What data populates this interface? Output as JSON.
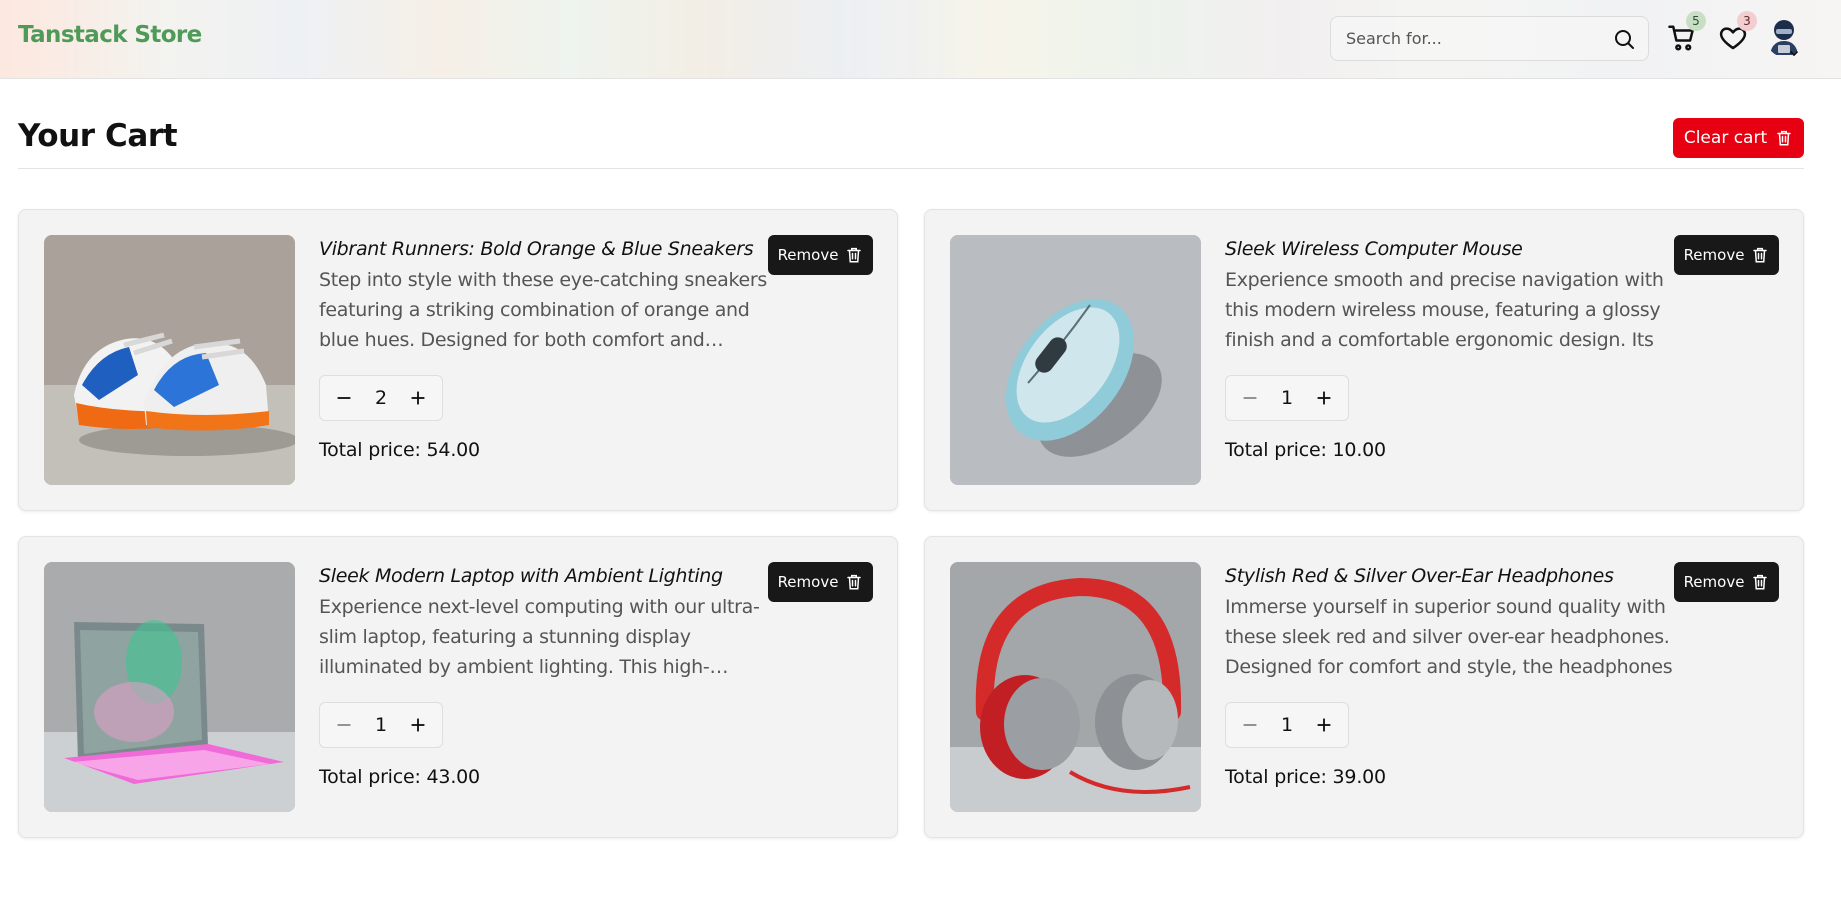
{
  "header": {
    "brand": "Tanstack Store",
    "search_placeholder": "Search for...",
    "cart_count": "5",
    "wishlist_count": "3",
    "brand_color": "#4f9a58"
  },
  "page": {
    "title": "Your Cart",
    "clear_cart_label": "Clear cart",
    "accent_color": "#e60012"
  },
  "cart_items": [
    {
      "title": "Vibrant Runners: Bold Orange & Blue Sneakers",
      "description": "Step into style with these eye-catching sneakers featuring a striking combination of orange and blue hues. Designed for both comfort and fashion",
      "quantity": "2",
      "total_price": "Total price: 54.00",
      "remove_label": "Remove",
      "image": "sneakers-photo"
    },
    {
      "title": "Sleek Wireless Computer Mouse",
      "description": "Experience smooth and precise navigation with this modern wireless mouse, featuring a glossy finish and a comfortable ergonomic design. Its",
      "quantity": "1",
      "total_price": "Total price: 10.00",
      "remove_label": "Remove",
      "image": "mouse-photo"
    },
    {
      "title": "Sleek Modern Laptop with Ambient Lighting",
      "description": "Experience next-level computing with our ultra-slim laptop, featuring a stunning display illuminated by ambient lighting. This high-performance",
      "quantity": "1",
      "total_price": "Total price: 43.00",
      "remove_label": "Remove",
      "image": "laptop-photo"
    },
    {
      "title": "Stylish Red & Silver Over-Ear Headphones",
      "description": "Immerse yourself in superior sound quality with these sleek red and silver over-ear headphones. Designed for comfort and style, the headphones",
      "quantity": "1",
      "total_price": "Total price: 39.00",
      "remove_label": "Remove",
      "image": "headphones-photo"
    }
  ]
}
